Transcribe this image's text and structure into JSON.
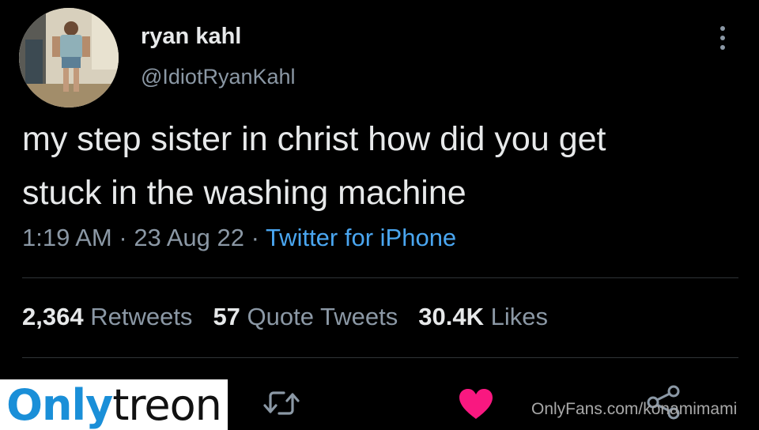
{
  "author": {
    "display_name": "ryan kahl",
    "handle": "@IdiotRyanKahl"
  },
  "tweet": {
    "text_line1": "my step sister in christ how did you get",
    "text_line2": "stuck in the washing machine",
    "time": "1:19 AM",
    "date": "23 Aug 22",
    "separator": " · ",
    "source": "Twitter for iPhone"
  },
  "stats": {
    "retweets_count": "2,364",
    "retweets_label": "Retweets",
    "quotes_count": "57",
    "quotes_label": "Quote Tweets",
    "likes_count": "30.4K",
    "likes_label": "Likes"
  },
  "icons": {
    "more": "more-vertical-icon",
    "retweet": "retweet-icon",
    "like": "heart-icon",
    "share": "share-icon"
  },
  "colors": {
    "background": "#000000",
    "link_blue": "#4aa6f0",
    "like_pink": "#f91880",
    "muted": "#8b98a5"
  },
  "logo": {
    "part1": "Only",
    "part2": "treon"
  },
  "watermark": "OnlyFans.com/konamimami"
}
